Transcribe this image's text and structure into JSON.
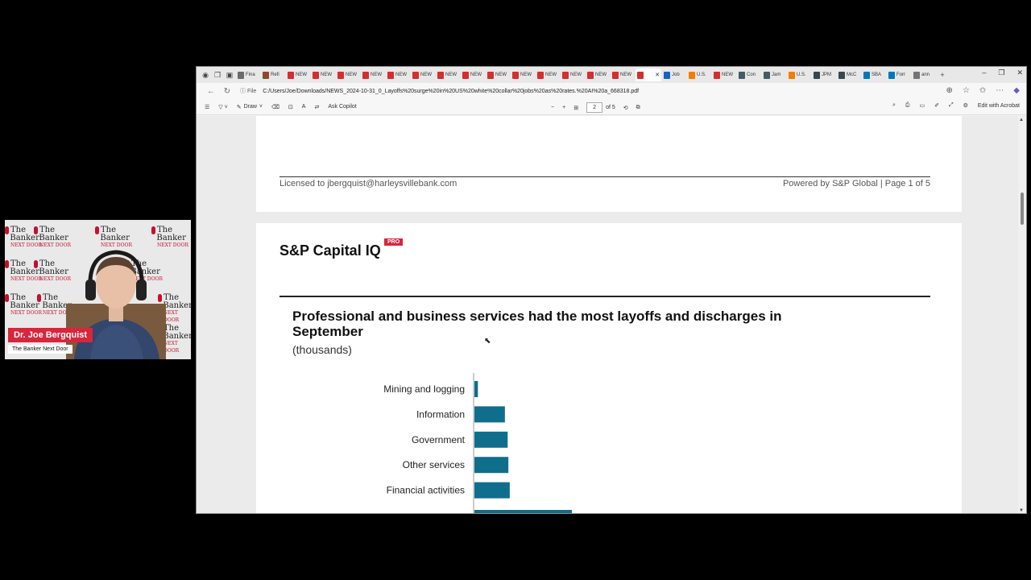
{
  "webcam": {
    "watermark_lines": [
      "The",
      "Banker",
      "NEXT DOOR"
    ],
    "name": "Dr. Joe Bergquist",
    "show": "The Banker Next Door"
  },
  "browser": {
    "tabs": [
      {
        "label": "Fina",
        "color": "#6b6b6b"
      },
      {
        "label": "Refi",
        "color": "#8a4b2a"
      },
      {
        "label": "NEW",
        "color": "#d32f2f"
      },
      {
        "label": "NEW",
        "color": "#d32f2f"
      },
      {
        "label": "NEW",
        "color": "#d32f2f"
      },
      {
        "label": "NEW",
        "color": "#d32f2f"
      },
      {
        "label": "NEW",
        "color": "#d32f2f"
      },
      {
        "label": "NEW",
        "color": "#d32f2f"
      },
      {
        "label": "NEW",
        "color": "#d32f2f"
      },
      {
        "label": "NEW",
        "color": "#d32f2f"
      },
      {
        "label": "NEW",
        "color": "#d32f2f"
      },
      {
        "label": "NEW",
        "color": "#d32f2f"
      },
      {
        "label": "NEW",
        "color": "#d32f2f"
      },
      {
        "label": "NEW",
        "color": "#d32f2f"
      },
      {
        "label": "NEW",
        "color": "#d32f2f"
      },
      {
        "label": "NEW",
        "color": "#d32f2f"
      },
      {
        "label": "",
        "color": "#d32f2f",
        "active": true
      },
      {
        "label": "Job",
        "color": "#1565c0"
      },
      {
        "label": "U.S.",
        "color": "#f57c00"
      },
      {
        "label": "NEW",
        "color": "#d32f2f"
      },
      {
        "label": "Con",
        "color": "#455a64"
      },
      {
        "label": "Jam",
        "color": "#455a64"
      },
      {
        "label": "U.S.",
        "color": "#f57c00"
      },
      {
        "label": "JPM",
        "color": "#37474f"
      },
      {
        "label": "McC",
        "color": "#37474f"
      },
      {
        "label": "SBA",
        "color": "#0277bd"
      },
      {
        "label": "Forr",
        "color": "#0277bd"
      },
      {
        "label": "ann",
        "color": "#757575"
      }
    ],
    "address": {
      "chip": "File",
      "url": "C:/Users/Joe/Downloads/NEWS_2024-10-31_0_Layoffs%20surge%20in%20US%20white%20collar%20jobs%20as%20rates.%20AI%20a_668318.pdf"
    },
    "pdf_toolbar": {
      "draw": "Draw",
      "ask": "Ask Copilot",
      "page_current": "2",
      "page_total": "of 5",
      "edit": "Edit with Acrobat"
    }
  },
  "document": {
    "page1": {
      "footer_left": "Licensed to jbergquist@harleysvillebank.com",
      "footer_right": "Powered by S&P Global | Page 1 of 5"
    },
    "page2": {
      "brand": "S&P Capital IQ",
      "badge": "PRO"
    }
  },
  "chart_data": {
    "type": "bar",
    "orientation": "horizontal",
    "title": "Professional and business services had the most layoffs and discharges in September",
    "subtitle": "(thousands)",
    "categories": [
      "Mining and logging",
      "Information",
      "Government",
      "Other services",
      "Financial activities"
    ],
    "values": [
      5,
      44,
      48,
      49,
      51
    ],
    "partially_visible_next_value": 121,
    "bar_color": "#0f6e8c",
    "gridlines": false
  }
}
